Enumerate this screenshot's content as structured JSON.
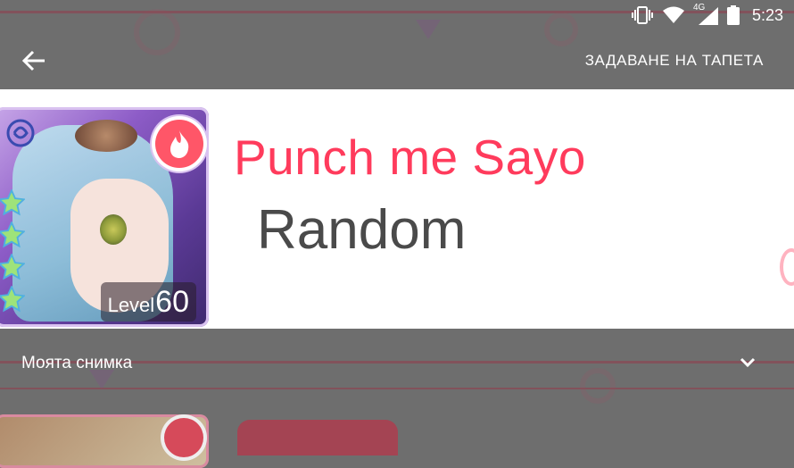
{
  "status_bar": {
    "time": "5:23",
    "network": "4G"
  },
  "app_bar": {
    "action_label": "ЗАДАВАНЕ НА ТАПЕТА"
  },
  "preview": {
    "card": {
      "level_label": "Level",
      "level_value": "60",
      "stars": 4
    },
    "title": "Punch me Sayo",
    "subtitle": "Random"
  },
  "photo_selector": {
    "label": "Моята снимка"
  },
  "colors": {
    "accent": "#ff3b5c",
    "subtitle": "#4a4a4a",
    "overlay": "#6e6e6e"
  }
}
